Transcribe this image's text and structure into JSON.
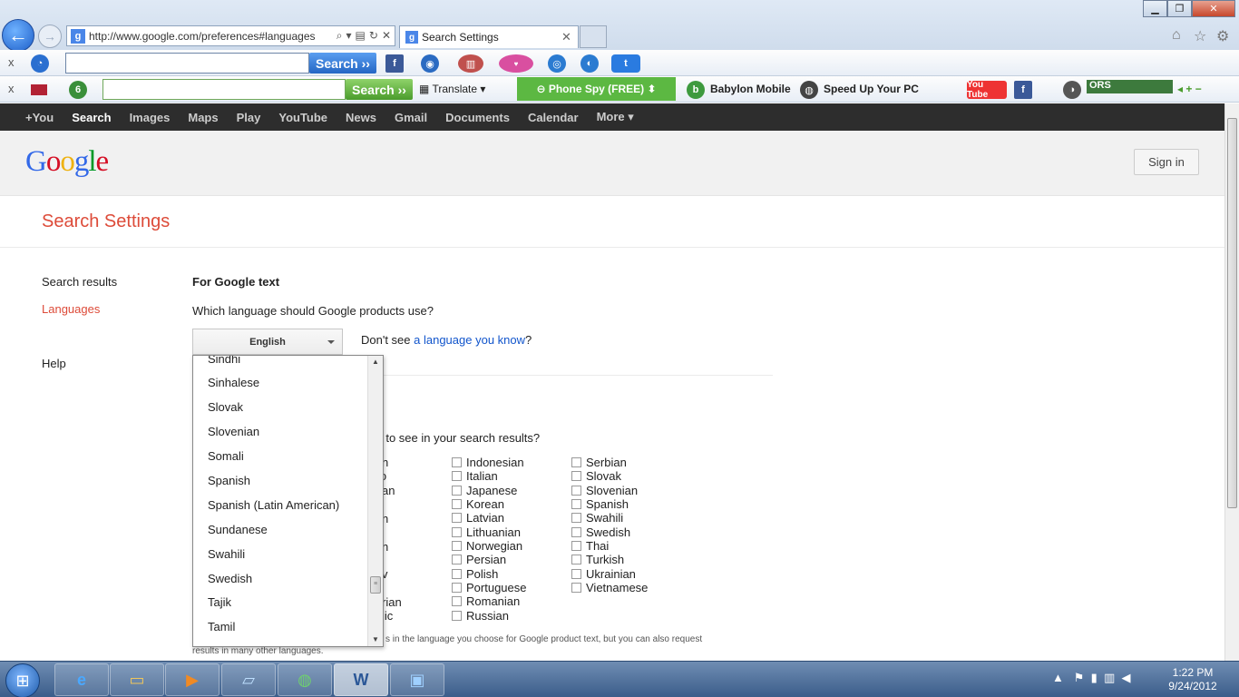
{
  "browser": {
    "url": "http://www.google.com/preferences#languages",
    "tab_title": "Search Settings",
    "toolbar1": {
      "search_label": "Search ››"
    },
    "toolbar2": {
      "search_label": "Search ››",
      "translate_label": "Translate",
      "phone_spy_label": "⊖ Phone Spy (FREE) ⬍",
      "babylon_label": "Babylon Mobile",
      "speedup_label": "Speed Up Your PC",
      "youtube_label": "You Tube",
      "ors_label": "ORS"
    }
  },
  "gbar": {
    "items": [
      "+You",
      "Search",
      "Images",
      "Maps",
      "Play",
      "YouTube",
      "News",
      "Gmail",
      "Documents",
      "Calendar",
      "More ▾"
    ]
  },
  "header": {
    "logo_text": "Google",
    "signin_label": "Sign in"
  },
  "page": {
    "title": "Search Settings",
    "nav": {
      "search_results": "Search results",
      "languages": "Languages",
      "help": "Help"
    },
    "section_heading": "For Google text",
    "question": "Which language should Google products use?",
    "selected_language": "English",
    "dont_see_prefix": "Don't see ",
    "dont_see_link": "a language you know",
    "dont_see_suffix": "?",
    "results_question_partial": "ke to see in your search results?",
    "partial_col1": [
      "n",
      "nto",
      "an",
      "",
      "n",
      "",
      "n",
      "",
      "v",
      "",
      "rian",
      "lic"
    ],
    "col2_languages": [
      "Indonesian",
      "Italian",
      "Japanese",
      "Korean",
      "Latvian",
      "Lithuanian",
      "Norwegian",
      "Persian",
      "Polish",
      "Portuguese",
      "Romanian",
      "Russian"
    ],
    "col3_languages": [
      "Serbian",
      "Slovak",
      "Slovenian",
      "Spanish",
      "Swahili",
      "Swedish",
      "Thai",
      "Turkish",
      "Ukrainian",
      "Vietnamese"
    ],
    "footnote_line1": "s in the language you choose for Google product text, but you can also request",
    "footnote_line2": "results in many other languages."
  },
  "dropdown": {
    "options": [
      "Sindhi",
      "Sinhalese",
      "Slovak",
      "Slovenian",
      "Somali",
      "Spanish",
      "Spanish (Latin American)",
      "Sundanese",
      "Swahili",
      "Swedish",
      "Tajik",
      "Tamil"
    ]
  },
  "taskbar": {
    "time": "1:22 PM",
    "date": "9/24/2012"
  }
}
